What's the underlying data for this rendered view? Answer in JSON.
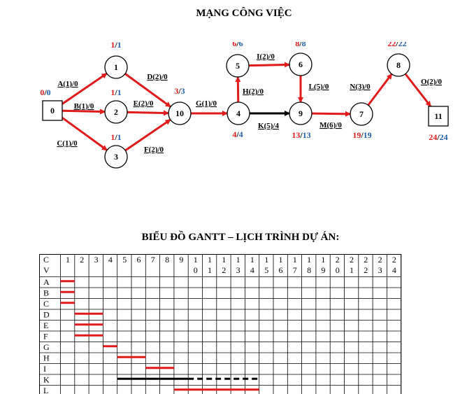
{
  "titles": {
    "network": "MẠNG CÔNG VIỆC",
    "gantt": "BIỂU ĐỒ GANTT – LỊCH TRÌNH DỰ ÁN:"
  },
  "colors": {
    "critical": "#e01b1b",
    "normal": "#000000",
    "early": "#e01b1b",
    "late": "#1f5fa8"
  },
  "network": {
    "nodes": [
      {
        "id": "0",
        "shape": "square",
        "early": "0",
        "late": "0"
      },
      {
        "id": "1",
        "shape": "circle",
        "early": "1",
        "late": "1"
      },
      {
        "id": "2",
        "shape": "circle",
        "early": "1",
        "late": "1"
      },
      {
        "id": "3",
        "shape": "circle",
        "early": "1",
        "late": "1"
      },
      {
        "id": "10",
        "shape": "circle",
        "early": "3",
        "late": "3"
      },
      {
        "id": "4",
        "shape": "circle",
        "early": "4",
        "late": "4"
      },
      {
        "id": "5",
        "shape": "circle",
        "early": "6",
        "late": "6"
      },
      {
        "id": "6",
        "shape": "circle",
        "early": "8",
        "late": "8"
      },
      {
        "id": "9",
        "shape": "circle",
        "early": "13",
        "late": "13"
      },
      {
        "id": "7",
        "shape": "circle",
        "early": "19",
        "late": "19"
      },
      {
        "id": "8",
        "shape": "circle",
        "early": "22",
        "late": "22"
      },
      {
        "id": "11",
        "shape": "square",
        "early": "24",
        "late": "24"
      }
    ],
    "edges": [
      {
        "from": "0",
        "to": "1",
        "label": "A(1)/0",
        "critical": true
      },
      {
        "from": "0",
        "to": "2",
        "label": "B(1)/0",
        "critical": true
      },
      {
        "from": "0",
        "to": "3",
        "label": "C(1)/0",
        "critical": true
      },
      {
        "from": "1",
        "to": "10",
        "label": "D(2)/0",
        "critical": true
      },
      {
        "from": "2",
        "to": "10",
        "label": "E(2)/0",
        "critical": true
      },
      {
        "from": "3",
        "to": "10",
        "label": "F(2)/0",
        "critical": true
      },
      {
        "from": "10",
        "to": "4",
        "label": "G(1)/0",
        "critical": true
      },
      {
        "from": "4",
        "to": "5",
        "label": "H(2)/0",
        "critical": true
      },
      {
        "from": "5",
        "to": "6",
        "label": "I(2)/0",
        "critical": true
      },
      {
        "from": "6",
        "to": "9",
        "label": "L(5)/0",
        "critical": true
      },
      {
        "from": "4",
        "to": "9",
        "label": "K(5)/4",
        "critical": false
      },
      {
        "from": "9",
        "to": "7",
        "label": "M(6)/0",
        "critical": true
      },
      {
        "from": "7",
        "to": "8",
        "label": "N(3)/0",
        "critical": true
      },
      {
        "from": "8",
        "to": "11",
        "label": "O(2)/0",
        "critical": true
      }
    ]
  },
  "gantt": {
    "corner_top": "C",
    "corner_bottom": "V",
    "columns": [
      {
        "top": "1",
        "bottom": ""
      },
      {
        "top": "2",
        "bottom": ""
      },
      {
        "top": "3",
        "bottom": ""
      },
      {
        "top": "4",
        "bottom": ""
      },
      {
        "top": "5",
        "bottom": ""
      },
      {
        "top": "6",
        "bottom": ""
      },
      {
        "top": "7",
        "bottom": ""
      },
      {
        "top": "8",
        "bottom": ""
      },
      {
        "top": "9",
        "bottom": ""
      },
      {
        "top": "1",
        "bottom": "0"
      },
      {
        "top": "1",
        "bottom": "1"
      },
      {
        "top": "1",
        "bottom": "2"
      },
      {
        "top": "1",
        "bottom": "3"
      },
      {
        "top": "1",
        "bottom": "4"
      },
      {
        "top": "1",
        "bottom": "5"
      },
      {
        "top": "1",
        "bottom": "6"
      },
      {
        "top": "1",
        "bottom": "7"
      },
      {
        "top": "1",
        "bottom": "8"
      },
      {
        "top": "1",
        "bottom": "9"
      },
      {
        "top": "2",
        "bottom": "0"
      },
      {
        "top": "2",
        "bottom": "1"
      },
      {
        "top": "2",
        "bottom": "2"
      },
      {
        "top": "2",
        "bottom": "3"
      },
      {
        "top": "2",
        "bottom": "4"
      }
    ],
    "rows": [
      "A",
      "B",
      "C",
      "D",
      "E",
      "F",
      "G",
      "H",
      "I",
      "K",
      "L"
    ],
    "tasks": [
      {
        "task": "A",
        "start": 0,
        "end": 1,
        "slack_end": null
      },
      {
        "task": "B",
        "start": 0,
        "end": 1,
        "slack_end": null
      },
      {
        "task": "C",
        "start": 0,
        "end": 1,
        "slack_end": null
      },
      {
        "task": "D",
        "start": 1,
        "end": 3,
        "slack_end": null
      },
      {
        "task": "E",
        "start": 1,
        "end": 3,
        "slack_end": null
      },
      {
        "task": "F",
        "start": 1,
        "end": 3,
        "slack_end": null
      },
      {
        "task": "G",
        "start": 3,
        "end": 4,
        "slack_end": null
      },
      {
        "task": "H",
        "start": 4,
        "end": 6,
        "slack_end": null
      },
      {
        "task": "I",
        "start": 6,
        "end": 8,
        "slack_end": null
      },
      {
        "task": "K",
        "start": 4,
        "end": 9,
        "slack_end": 14
      },
      {
        "task": "L",
        "start": 8,
        "end": 14,
        "slack_end": null
      }
    ]
  }
}
